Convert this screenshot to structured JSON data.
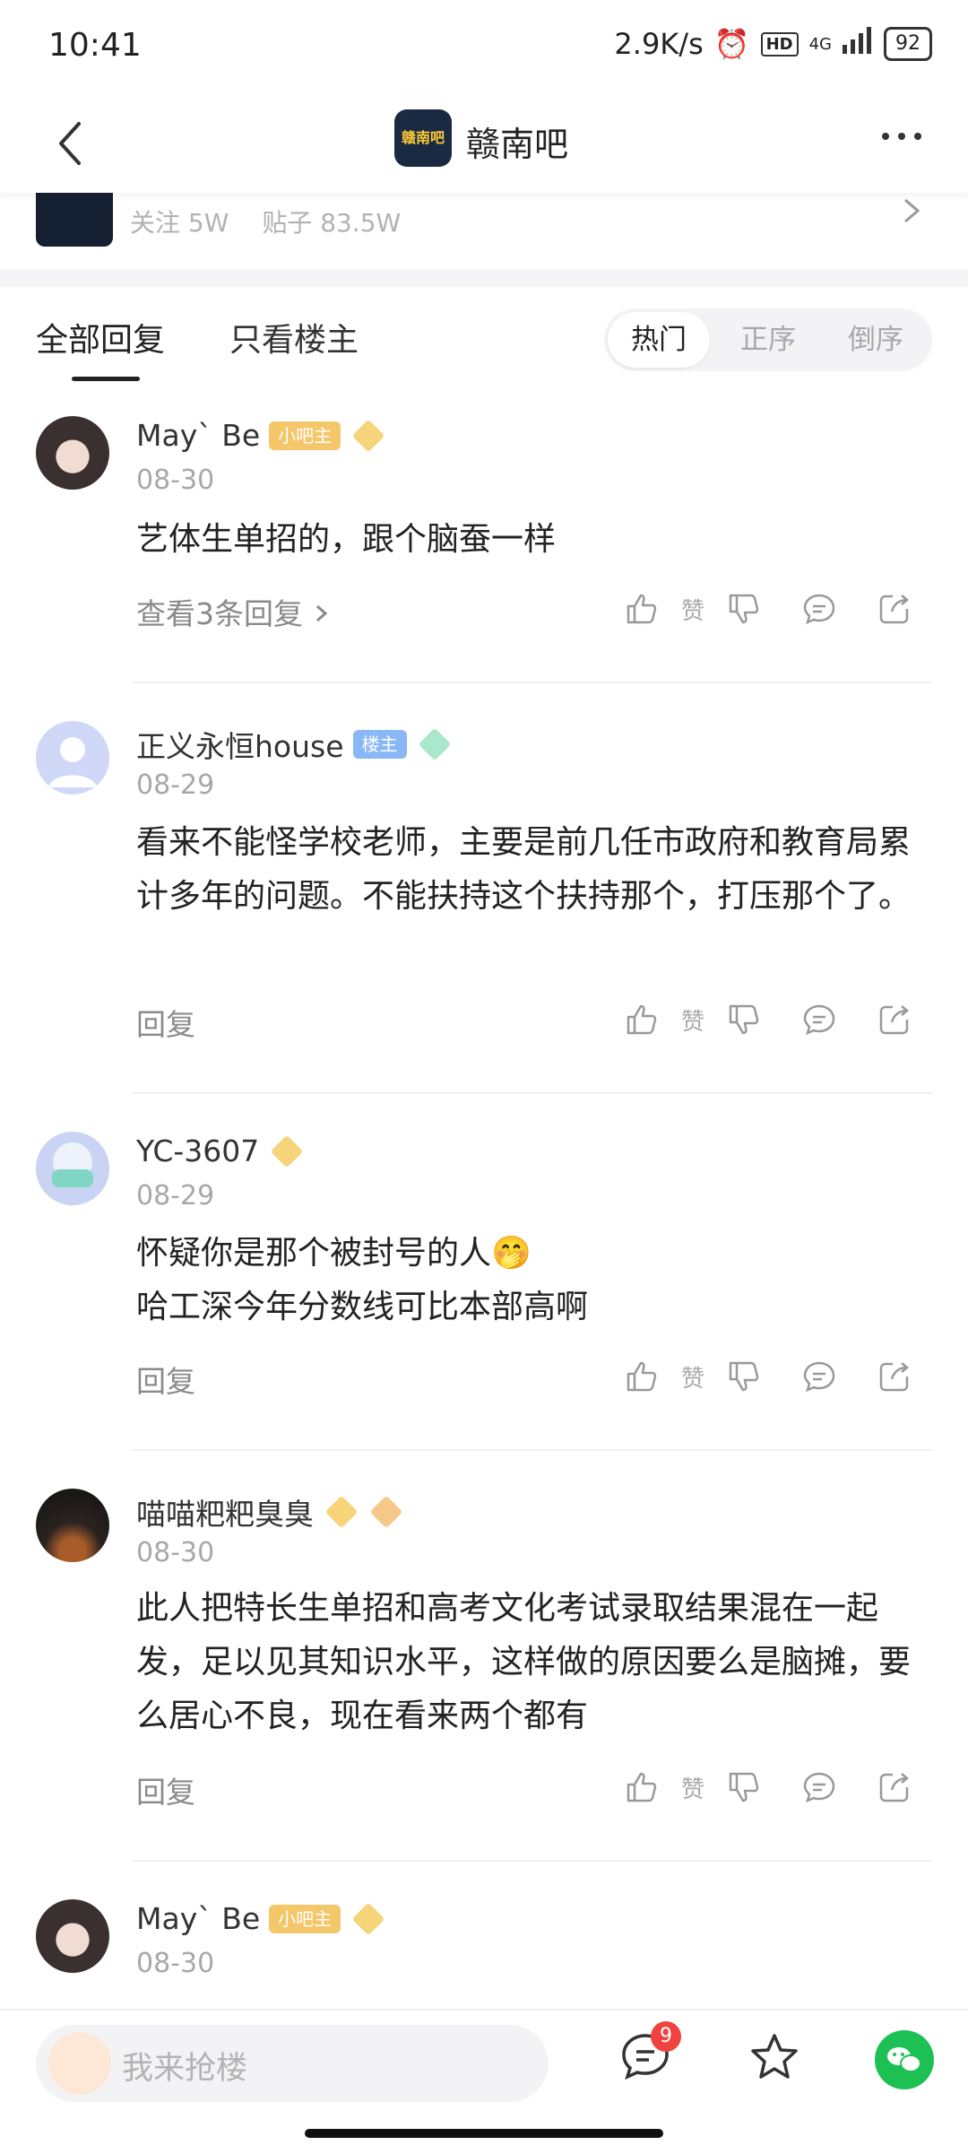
{
  "status_bar": {
    "time": "10:41",
    "speed": "2.9K/s",
    "hd": "HD",
    "network": "4G",
    "battery": "92"
  },
  "nav": {
    "title": "赣南吧",
    "logo_text": "赣南吧"
  },
  "forum": {
    "follow": "关注 5W",
    "posts": "贴子 83.5W"
  },
  "tabs": {
    "all": "全部回复",
    "op_only": "只看楼主"
  },
  "sort": {
    "hot": "热门",
    "asc": "正序",
    "desc": "倒序"
  },
  "actions": {
    "like_label": "赞"
  },
  "comments": [
    {
      "name": "May` Be",
      "badge": "小吧主",
      "level": "10",
      "date": "08-30",
      "text": "艺体生单招的，跟个脑蚕一样",
      "reply": "查看3条回复"
    },
    {
      "name": "正义永恒house",
      "badge": "楼主",
      "date": "08-29",
      "text": "看来不能怪学校老师，主要是前几任市政府和教育局累计多年的问题。不能扶持这个扶持那个，打压那个了。",
      "reply": "回复"
    },
    {
      "name": "YC-3607",
      "level": "10",
      "date": "08-29",
      "text_line1": "怀疑你是那个被封号的人",
      "text_emoji": "🤭",
      "text_line2": "哈工深今年分数线可比本部高啊",
      "reply": "回复"
    },
    {
      "name": "喵喵粑粑臭臭",
      "level": "12",
      "extra_badge": "5",
      "date": "08-30",
      "text": "此人把特长生单招和高考文化考试录取结果混在一起发，足以见其知识水平，这样做的原因要么是脑摊，要么居心不良，现在看来两个都有",
      "reply": "回复"
    },
    {
      "name": "May` Be",
      "badge": "小吧主",
      "level": "10",
      "date": "08-30"
    }
  ],
  "bottom": {
    "placeholder": "我来抢楼",
    "notif_count": "9"
  },
  "colors": {
    "accent_green": "#1dc153",
    "badge_red": "#f0433f",
    "owner_badge": "#f4c76a",
    "lz_badge": "#8ab7f5"
  }
}
